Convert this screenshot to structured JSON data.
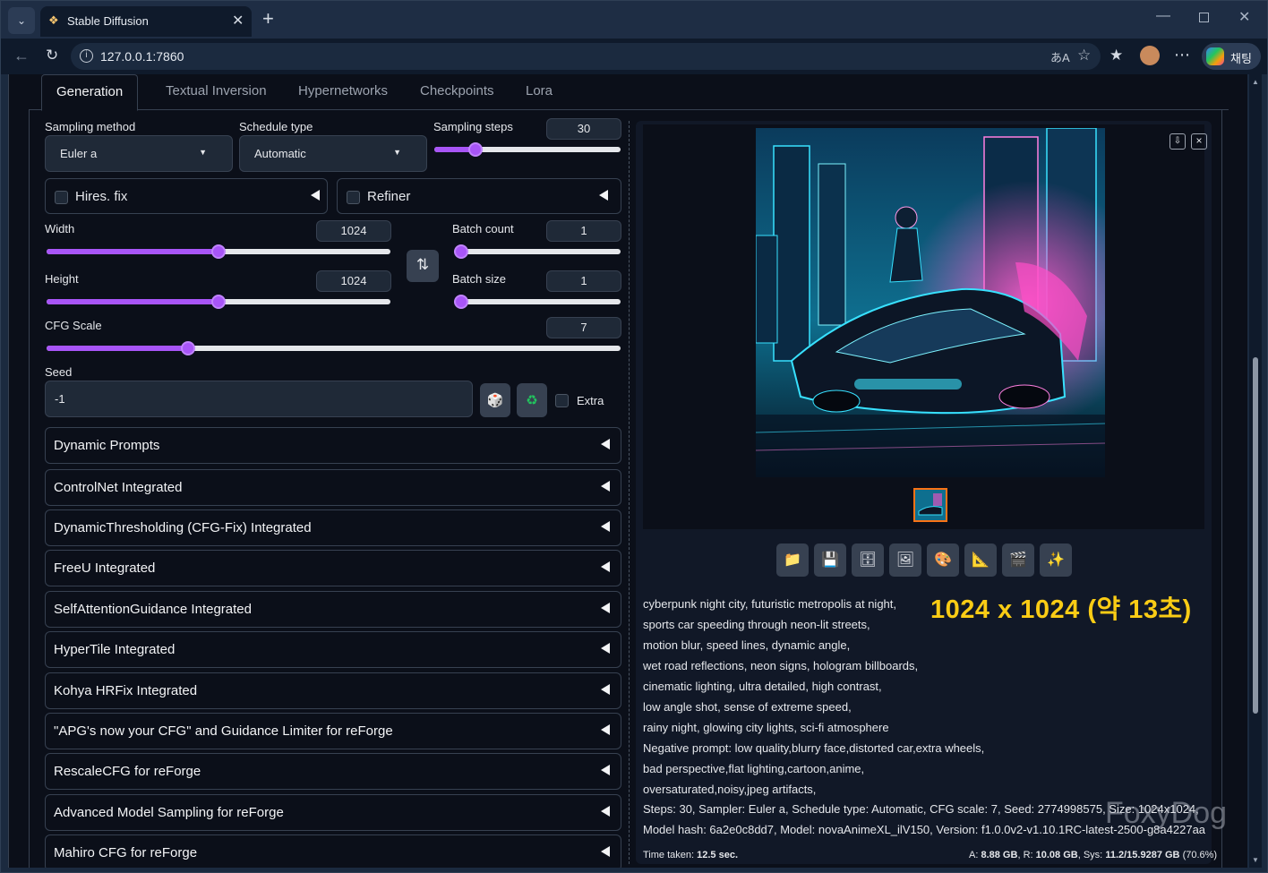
{
  "browser": {
    "tab_title": "Stable Diffusion",
    "url": "127.0.0.1:7860",
    "copilot_label": "채팅"
  },
  "tabs": [
    "Generation",
    "Textual Inversion",
    "Hypernetworks",
    "Checkpoints",
    "Lora"
  ],
  "sampling": {
    "method_label": "Sampling method",
    "method_value": "Euler a",
    "schedule_label": "Schedule type",
    "schedule_value": "Automatic",
    "steps_label": "Sampling steps",
    "steps_value": "30",
    "steps_fraction": 0.2
  },
  "hires_label": "Hires. fix",
  "refiner_label": "Refiner",
  "size": {
    "width_label": "Width",
    "width_value": "1024",
    "width_fraction": 0.5,
    "height_label": "Height",
    "height_value": "1024",
    "height_fraction": 0.5
  },
  "batch": {
    "count_label": "Batch count",
    "count_value": "1",
    "count_fraction": 0.0,
    "size_label": "Batch size",
    "size_value": "1",
    "size_fraction": 0.0
  },
  "cfg": {
    "label": "CFG Scale",
    "value": "7",
    "fraction": 0.24
  },
  "seed": {
    "label": "Seed",
    "value": "-1",
    "extra_label": "Extra"
  },
  "accordions": [
    "Dynamic Prompts",
    "ControlNet Integrated",
    "DynamicThresholding (CFG-Fix) Integrated",
    "FreeU Integrated",
    "SelfAttentionGuidance Integrated",
    "HyperTile Integrated",
    "Kohya HRFix Integrated",
    "\"APG's now your CFG\" and Guidance Limiter for reForge",
    "RescaleCFG for reForge",
    "Advanced Model Sampling for reForge",
    "Mahiro CFG for reForge"
  ],
  "tools": [
    "folder-icon",
    "save-icon",
    "zip-icon",
    "image-icon",
    "palette-icon",
    "ruler-icon",
    "clapper-icon",
    "sparkle-icon"
  ],
  "prompt_lines": [
    "cyberpunk night city, futuristic metropolis at night,",
    "sports car speeding through neon-lit streets,",
    "motion blur, speed lines, dynamic angle,",
    "wet road reflections, neon signs, hologram billboards,",
    "cinematic lighting, ultra detailed, high contrast,",
    "low angle shot, sense of extreme speed,",
    "rainy night, glowing city lights, sci-fi atmosphere",
    "Negative prompt: low quality,blurry face,distorted car,extra wheels,",
    "bad perspective,flat lighting,cartoon,anime,",
    "oversaturated,noisy,jpeg artifacts,"
  ],
  "params_line": "Steps: 30, Sampler: Euler a, Schedule type: Automatic, CFG scale: 7, Seed: 2774998575, Size: 1024x1024,",
  "model_line": "Model hash: 6a2e0c8dd7, Model: novaAnimeXL_ilV150, Version: f1.0.0v2-v1.10.1RC-latest-2500-g8a4227aa",
  "overlay_text": "1024 x 1024 (약 13초)",
  "watermark": "FoxyDog",
  "time_prefix": "Time taken: ",
  "time_value": "12.5 sec.",
  "vram": {
    "a_label": "A:",
    "a_value": "8.88 GB",
    "r_label": "R:",
    "r_value": "10.08 GB",
    "sys_label": "Sys:",
    "sys_value": "11.2/15.9287 GB",
    "pct": "(70.6%)"
  },
  "colors": {
    "accent": "#a855f7",
    "overlay": "#facc15"
  }
}
